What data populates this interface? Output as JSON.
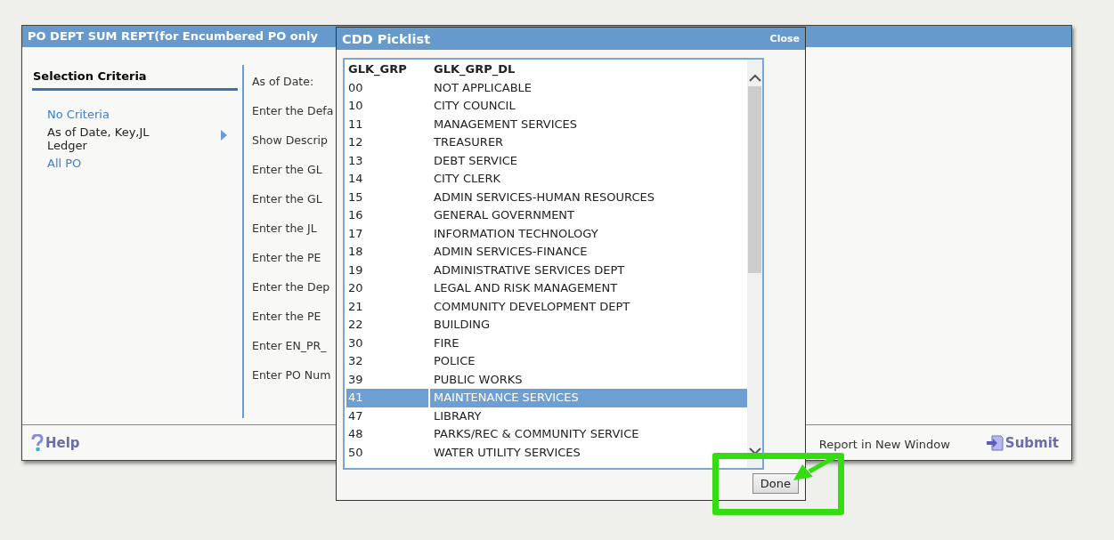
{
  "window": {
    "title": "PO DEPT SUM REPT(for Encumbered PO only"
  },
  "sidebar": {
    "heading": "Selection Criteria",
    "items": [
      {
        "label": "No Criteria",
        "selected": false
      },
      {
        "label": "As of Date, Key,JL Ledger",
        "selected": true
      },
      {
        "label": "All PO",
        "selected": false
      }
    ]
  },
  "fields": [
    "As of Date:",
    "Enter the Defa",
    "Show Descrip",
    "Enter the GL",
    "Enter the GL",
    "Enter the JL",
    "Enter the PE",
    "Enter the Dep",
    "Enter the PE",
    "Enter EN_PR_",
    "Enter PO Num"
  ],
  "footer": {
    "help": "Help",
    "report_option": "Report in New Window",
    "submit": "Submit"
  },
  "picklist": {
    "title": "CDD Picklist",
    "close": "Close",
    "columns": [
      "GLK_GRP",
      "GLK_GRP_DL"
    ],
    "rows": [
      {
        "code": "00",
        "name": "NOT APPLICABLE",
        "selected": false
      },
      {
        "code": "10",
        "name": "CITY COUNCIL",
        "selected": false
      },
      {
        "code": "11",
        "name": "MANAGEMENT SERVICES",
        "selected": false
      },
      {
        "code": "12",
        "name": "TREASURER",
        "selected": false
      },
      {
        "code": "13",
        "name": "DEBT SERVICE",
        "selected": false
      },
      {
        "code": "14",
        "name": "CITY CLERK",
        "selected": false
      },
      {
        "code": "15",
        "name": "ADMIN SERVICES-HUMAN RESOURCES",
        "selected": false
      },
      {
        "code": "16",
        "name": "GENERAL GOVERNMENT",
        "selected": false
      },
      {
        "code": "17",
        "name": "INFORMATION TECHNOLOGY",
        "selected": false
      },
      {
        "code": "18",
        "name": "ADMIN SERVICES-FINANCE",
        "selected": false
      },
      {
        "code": "19",
        "name": "ADMINISTRATIVE SERVICES DEPT",
        "selected": false
      },
      {
        "code": "20",
        "name": "LEGAL AND RISK MANAGEMENT",
        "selected": false
      },
      {
        "code": "21",
        "name": "COMMUNITY DEVELOPMENT DEPT",
        "selected": false
      },
      {
        "code": "22",
        "name": "BUILDING",
        "selected": false
      },
      {
        "code": "30",
        "name": "FIRE",
        "selected": false
      },
      {
        "code": "32",
        "name": "POLICE",
        "selected": false
      },
      {
        "code": "39",
        "name": "PUBLIC WORKS",
        "selected": false
      },
      {
        "code": "41",
        "name": "MAINTENANCE SERVICES",
        "selected": true
      },
      {
        "code": "47",
        "name": "LIBRARY",
        "selected": false
      },
      {
        "code": "48",
        "name": "PARKS/REC & COMMUNITY SERVICE",
        "selected": false
      },
      {
        "code": "50",
        "name": "WATER UTILITY SERVICES",
        "selected": false
      }
    ],
    "done": "Done"
  }
}
